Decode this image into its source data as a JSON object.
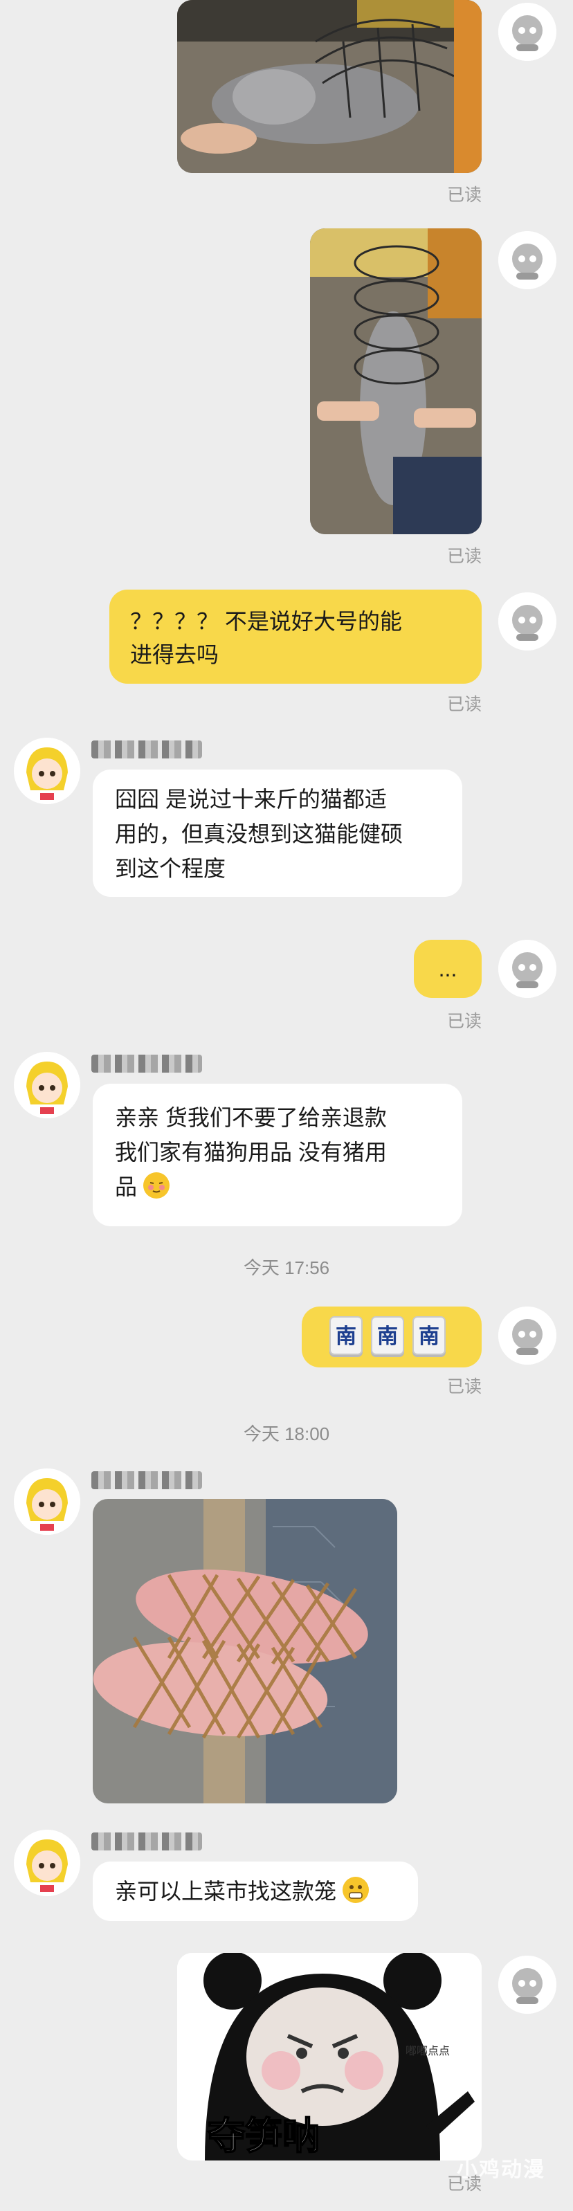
{
  "chat": {
    "read_label": "已读",
    "messages": [
      {
        "id": "m5",
        "text_line1": "？？？？ 不是说好大号的能",
        "text_line2": "进得去吗"
      },
      {
        "id": "m6",
        "line1": "囧囧 是说过十来斤的猫都适",
        "line2": "用的，但真没想到这猫能健硕",
        "line3": "到这个程度"
      },
      {
        "id": "m7",
        "text": "..."
      },
      {
        "id": "m8",
        "line1": "亲亲 货我们不要了给亲退款",
        "line2": "我们家有猫狗用品 没有猪用",
        "line3": "品"
      },
      {
        "id": "m9",
        "tiles": [
          "南",
          "南",
          "南"
        ]
      },
      {
        "id": "m10",
        "text": "亲可以上菜市找这款笼"
      }
    ],
    "time_1": "今天 17:56",
    "time_2": "今天 18:00",
    "sticker_caption": "夺笋呐",
    "sticker_small_text": "嘟嘟点点"
  },
  "watermark": "小鸡动漫",
  "colors": {
    "background": "#ededed",
    "my_bubble": "#f8d84a",
    "their_bubble": "#ffffff"
  }
}
